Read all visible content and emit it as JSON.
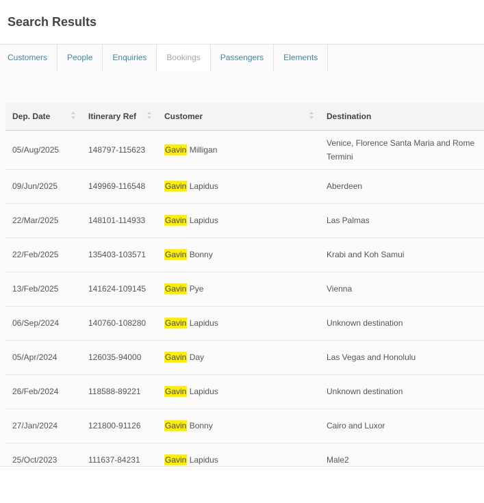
{
  "page": {
    "title": "Search Results"
  },
  "tabs": [
    {
      "label": "Customers",
      "active": false
    },
    {
      "label": "People",
      "active": false
    },
    {
      "label": "Enquiries",
      "active": false
    },
    {
      "label": "Bookings",
      "active": true
    },
    {
      "label": "Passengers",
      "active": false
    },
    {
      "label": "Elements",
      "active": false
    }
  ],
  "table": {
    "columns": [
      "Dep. Date",
      "Itinerary Ref",
      "Customer",
      "Destination"
    ],
    "rows": [
      {
        "date": "05/Aug/2025",
        "ref": "148797-115623",
        "first": "Gavin",
        "last": "Milligan",
        "destination": "Venice, Florence Santa Maria and Rome Termini"
      },
      {
        "date": "09/Jun/2025",
        "ref": "149969-116548",
        "first": "Gavin",
        "last": "Lapidus",
        "destination": "Aberdeen"
      },
      {
        "date": "22/Mar/2025",
        "ref": "148101-114933",
        "first": "Gavin",
        "last": "Lapidus",
        "destination": "Las Palmas"
      },
      {
        "date": "22/Feb/2025",
        "ref": "135403-103571",
        "first": "Gavin",
        "last": "Bonny",
        "destination": "Krabi and Koh Samui"
      },
      {
        "date": "13/Feb/2025",
        "ref": "141624-109145",
        "first": "Gavin",
        "last": "Pye",
        "destination": "Vienna"
      },
      {
        "date": "06/Sep/2024",
        "ref": "140760-108280",
        "first": "Gavin",
        "last": "Lapidus",
        "destination": "Unknown destination"
      },
      {
        "date": "05/Apr/2024",
        "ref": "126035-94000",
        "first": "Gavin",
        "last": "Day",
        "destination": "Las Vegas and Honolulu"
      },
      {
        "date": "26/Feb/2024",
        "ref": "118588-89221",
        "first": "Gavin",
        "last": "Lapidus",
        "destination": "Unknown destination"
      },
      {
        "date": "27/Jan/2024",
        "ref": "121800-91126",
        "first": "Gavin",
        "last": "Bonny",
        "destination": "Cairo and Luxor"
      },
      {
        "date": "25/Oct/2023",
        "ref": "111637-84231",
        "first": "Gavin",
        "last": "Lapidus",
        "destination": "Male2"
      }
    ]
  },
  "colors": {
    "link": "#3f86ae",
    "highlight": "#fff000",
    "header_bg": "#f4f4f4"
  }
}
